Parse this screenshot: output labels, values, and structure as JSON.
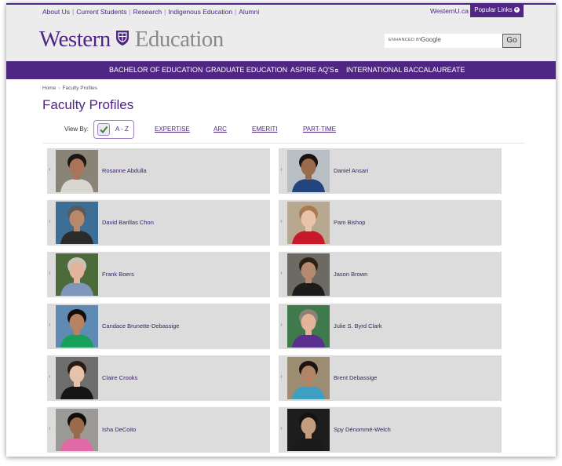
{
  "utility_nav": {
    "links": [
      "About Us",
      "Current Students",
      "Research",
      "Indigenous Education",
      "Alumni"
    ],
    "westernu": "WesternU.ca",
    "popular_links": "Popular Links"
  },
  "logo": {
    "part1": "Western",
    "part2": "Education"
  },
  "search": {
    "enhanced_label": "ENHANCED BY",
    "google": "Google",
    "go_button": "Go"
  },
  "main_nav": {
    "items": [
      "BACHELOR OF EDUCATION",
      "GRADUATE EDUCATION",
      "ASPIRE AQ'S",
      "INTERNATIONAL BACCALAUREATE"
    ]
  },
  "breadcrumb": {
    "home": "Home",
    "current": "Faculty Profiles"
  },
  "page_title": "Faculty Profiles",
  "view_by": {
    "label": "View By:",
    "active": "A - Z",
    "tabs": [
      "EXPERTISE",
      "ARC",
      "EMERITI",
      "PART-TIME"
    ]
  },
  "faculty": [
    {
      "name": "Rosanne Abdulla",
      "bg": "#8a8478",
      "skin": "#a9755a",
      "hair": "#1e1410",
      "shirt": "#d9d6d0"
    },
    {
      "name": "Daniel Ansari",
      "bg": "#b9bec4",
      "skin": "#9a6b4c",
      "hair": "#1a1410",
      "shirt": "#22457d"
    },
    {
      "name": "David Barillas Chon",
      "bg": "#3d6f96",
      "skin": "#b98a6a",
      "hair": "#5a5a5a",
      "shirt": "#2b2b2b"
    },
    {
      "name": "Pam Bishop",
      "bg": "#b9a890",
      "skin": "#e8c3a8",
      "hair": "#a87a4e",
      "shirt": "#c8192c"
    },
    {
      "name": "Frank Boers",
      "bg": "#4d6a3b",
      "skin": "#e1b49d",
      "hair": "#c9c2b5",
      "shirt": "#7e96b8"
    },
    {
      "name": "Jason Brown",
      "bg": "#6c6a62",
      "skin": "#b58a6e",
      "hair": "#2b2018",
      "shirt": "#1c1c1c"
    },
    {
      "name": "Candace Brunette-Debassige",
      "bg": "#5e8ab3",
      "skin": "#b7825f",
      "hair": "#120c0a",
      "shirt": "#16a05a"
    },
    {
      "name": "Julie S. Byrd Clark",
      "bg": "#3e7a4c",
      "skin": "#e3b49a",
      "hair": "#8a8276",
      "shirt": "#5a2f8e"
    },
    {
      "name": "Claire Crooks",
      "bg": "#6e6e6e",
      "skin": "#e6c2aa",
      "hair": "#2a1c14",
      "shirt": "#151515"
    },
    {
      "name": "Brent Debassige",
      "bg": "#9c8c72",
      "skin": "#b28466",
      "hair": "#1b1410",
      "shirt": "#3d9fc2"
    },
    {
      "name": "Isha DeCoito",
      "bg": "#9b9a96",
      "skin": "#9a6a4c",
      "hair": "#120c0a",
      "shirt": "#e06aa6"
    },
    {
      "name": "Spy Dénommé-Welch",
      "bg": "#1d1d1d",
      "skin": "#c49c7e",
      "hair": "#161210",
      "shirt": "#1a1a1a"
    }
  ],
  "colors": {
    "brand_purple": "#4f2683",
    "header_gray": "#ececec",
    "card_gray": "#dcdcdc"
  }
}
